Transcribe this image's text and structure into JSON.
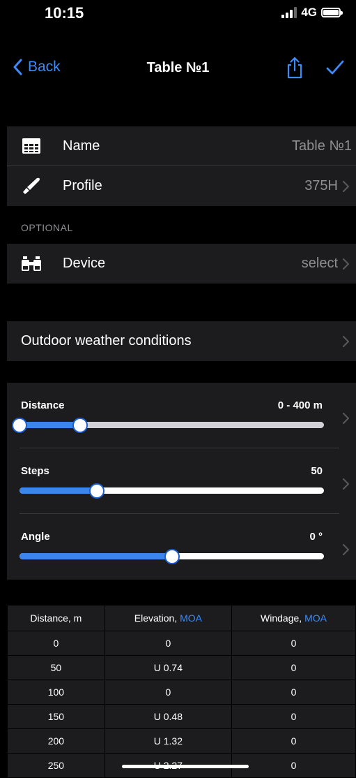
{
  "status": {
    "time": "10:15",
    "network": "4G",
    "signal_bars": 3
  },
  "nav": {
    "back_label": "Back",
    "title": "Table №1"
  },
  "basic": {
    "name_label": "Name",
    "name_value": "Table №1",
    "profile_label": "Profile",
    "profile_value": "375H"
  },
  "optional_header": "OPTIONAL",
  "device": {
    "label": "Device",
    "value": "select"
  },
  "weather": {
    "label": "Outdoor weather conditions"
  },
  "sliders": {
    "distance": {
      "label": "Distance",
      "value": "0 - 400 m",
      "range_fraction": [
        0.0,
        0.2
      ]
    },
    "steps": {
      "label": "Steps",
      "value": "50",
      "fraction": 0.255
    },
    "angle": {
      "label": "Angle",
      "value": "0 °",
      "fraction": 0.5
    }
  },
  "table": {
    "headers": [
      {
        "text": "Distance, m",
        "unit": ""
      },
      {
        "text": "Elevation, ",
        "unit": "MOA"
      },
      {
        "text": "Windage, ",
        "unit": "MOA"
      }
    ],
    "rows": [
      [
        "0",
        "0",
        "0"
      ],
      [
        "50",
        "U 0.74",
        "0"
      ],
      [
        "100",
        "0",
        "0"
      ],
      [
        "150",
        "U 0.48",
        "0"
      ],
      [
        "200",
        "U 1.32",
        "0"
      ],
      [
        "250",
        "U 2.27",
        "0"
      ]
    ]
  },
  "colors": {
    "accent": "#3d8bf7",
    "background": "#000000",
    "cell": "#1c1c1e"
  }
}
